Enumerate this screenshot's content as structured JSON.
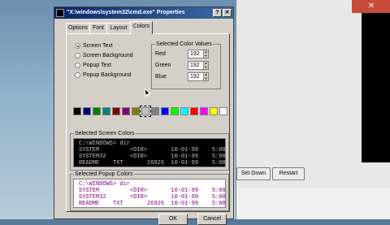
{
  "window": {
    "title": "\"X:\\windows\\system32\\cmd.exe\" Properties"
  },
  "tabs": [
    "Options",
    "Font",
    "Layout",
    "Colors"
  ],
  "radios": [
    {
      "label": "Screen Text",
      "checked": true
    },
    {
      "label": "Screen Background",
      "checked": false
    },
    {
      "label": "Popup Text",
      "checked": false
    },
    {
      "label": "Popup Background",
      "checked": false
    }
  ],
  "selected_color_values": {
    "label": "Selected Color Values",
    "fields": [
      {
        "label": "Red",
        "value": "192"
      },
      {
        "label": "Green",
        "value": "192"
      },
      {
        "label": "Blue",
        "value": "192"
      }
    ]
  },
  "palette": {
    "colors": [
      "#000000",
      "#000080",
      "#008000",
      "#008080",
      "#800000",
      "#800080",
      "#808000",
      "#c0c0c0",
      "#808080",
      "#0000ff",
      "#00ff00",
      "#00ffff",
      "#ff0000",
      "#ff00ff",
      "#ffff00",
      "#ffffff"
    ],
    "selected_index": 7
  },
  "screen_preview": {
    "label": "Selected Screen Colors",
    "text_color": "#c0c0c0",
    "background": "#000000",
    "lines": [
      "C:\\WINDOWS> dir",
      "SYSTEM         <DIR>       10-01-99    5:00",
      "SYSTEM32       <DIR>       10-01-99    5:00",
      "README    TXT       26926  10-01-99    5:00"
    ]
  },
  "popup_preview": {
    "label": "Selected Popup Colors",
    "text_color": "#800080",
    "background": "#ffffff",
    "lines": [
      "C:\\WINDOWS> dir",
      "SYSTEM         <DIR>       10-01-99    5:00",
      "SYSTEM32       <DIR>       10-01-99    5:00",
      "README    TXT       26926  10-01-99    5:00"
    ]
  },
  "buttons": {
    "ok": "OK",
    "cancel": "Cancel"
  },
  "background_window": {
    "buttons": [
      "Set Down",
      "Restart"
    ]
  }
}
